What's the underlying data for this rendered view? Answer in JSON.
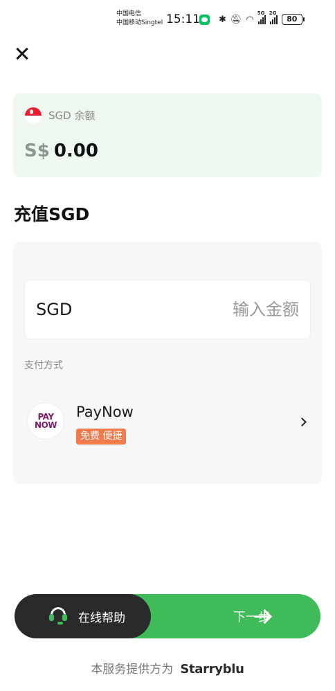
{
  "status_bar": {
    "carrier_1": "中国电信",
    "carrier_2": "中国移动Singtel",
    "time": "15:11",
    "network_1": "5G",
    "network_2": "2G",
    "battery": "80"
  },
  "balance": {
    "label": "SGD 余额",
    "currency_symbol": "S$",
    "amount": "0.00"
  },
  "recharge": {
    "title": "充值SGD",
    "currency": "SGD",
    "amount_placeholder": "输入金额",
    "payment_label": "支付方式",
    "payment_method": {
      "logo_line_1": "PAY",
      "logo_line_2": "NOW",
      "name": "PayNow",
      "badge": "免费 便捷"
    }
  },
  "actions": {
    "help_label": "在线帮助",
    "next_label": "下一步"
  },
  "footer": {
    "provided_by": "本服务提供方为",
    "brand": "Starryblu"
  },
  "colors": {
    "accent_green": "#3fbb5a",
    "badge_orange": "#f07b4d",
    "balance_bg": "#eef8f0",
    "dark_button": "#2a2a2a"
  }
}
